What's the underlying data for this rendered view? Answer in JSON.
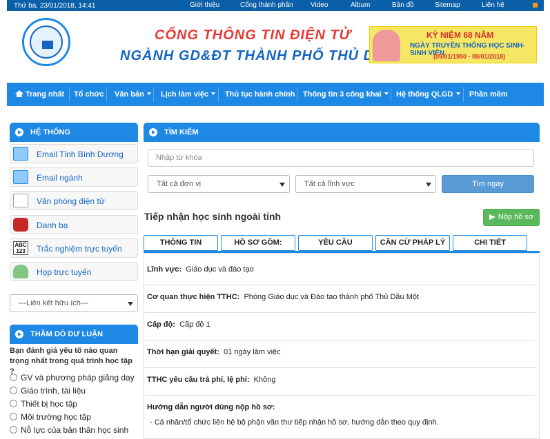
{
  "topbar": {
    "date": "Thứ ba, 23/01/2018, 14:41",
    "links": [
      "Giới thiệu",
      "Cổng thành phần",
      "Video",
      "Album",
      "Bản đồ",
      "Sitemap",
      "Liên hệ"
    ]
  },
  "header": {
    "title_line1": "CỔNG THÔNG TIN ĐIỆN TỬ",
    "title_line2": "NGÀNH GD&ĐT THÀNH PHỐ THỦ DẦU MỘT",
    "banner_line1": "KỶ NIỆM 68 NĂM",
    "banner_line2": "NGÀY TRUYỀN THỐNG HỌC SINH-SINH VIÊN",
    "banner_line3": "(09/01/1950 - 09/01/2018)"
  },
  "nav": {
    "items": [
      "Trang nhất",
      "Tổ chức",
      "Văn bản",
      "Lịch làm việc",
      "Thủ tục hành chính",
      "Thông tin 3 công khai",
      "Hệ thống QLGD",
      "Phần mềm"
    ]
  },
  "sidebar": {
    "system_title": "HỆ THỐNG",
    "items": [
      "Email Tỉnh Bình Dương",
      "Email ngành",
      "Văn phòng điện tử",
      "Danh bạ",
      "Trắc nghiệm trực tuyến",
      "Họp trực tuyến"
    ],
    "links_select": "---Liên kết hữu ích---",
    "poll_title": "THĂM DÒ DƯ LUẬN",
    "poll_question": "Bạn đánh giá yếu tố nào quan trọng nhất trong quá trình học tập ?",
    "poll_options": [
      "GV và phương pháp giảng dạy",
      "Giáo trình, tài liệu",
      "Thiết bị học tập",
      "Môi trường học tập",
      "Nỗ lực của bản thân học sinh"
    ]
  },
  "search": {
    "title": "TÌM KIẾM",
    "placeholder": "Nhập từ khóa",
    "unit_select": "Tất cả đơn vị",
    "field_select": "Tất cả lĩnh vực",
    "button": "Tìm ngay"
  },
  "procedure": {
    "title": "Tiếp nhận học sinh ngoài tỉnh",
    "submit_button": "Nộp hồ sơ",
    "tabs": [
      "THÔNG TIN",
      "HỒ SƠ GỒM:",
      "YÊU CẦU",
      "CĂN CỨ PHÁP LÝ",
      "CHI TIẾT"
    ],
    "rows": [
      {
        "label": "Lĩnh vực:",
        "value": "Giáo dục và đào tạo"
      },
      {
        "label": "Cơ quan thực hiện TTHC:",
        "value": "Phòng Giáo dục và Đào tạo thành phố Thủ Dầu Một"
      },
      {
        "label": "Cấp độ:",
        "value": "Cấp độ 1"
      },
      {
        "label": "Thời hạn giải quyết:",
        "value": "01 ngày làm việc"
      },
      {
        "label": "TTHC yêu cầu trả phí, lệ phí:",
        "value": "Không"
      }
    ],
    "guide_title": "Hướng dẫn người dùng nộp hồ sơ:",
    "guide_text": "- Cá nhân/tổ chức liên hệ bộ phận văn thư tiếp nhận hồ sơ, hướng dẫn theo quy định."
  },
  "colors": {
    "primary": "#1e88e5",
    "topbar": "#0b5fa8",
    "success": "#5cb85c"
  }
}
